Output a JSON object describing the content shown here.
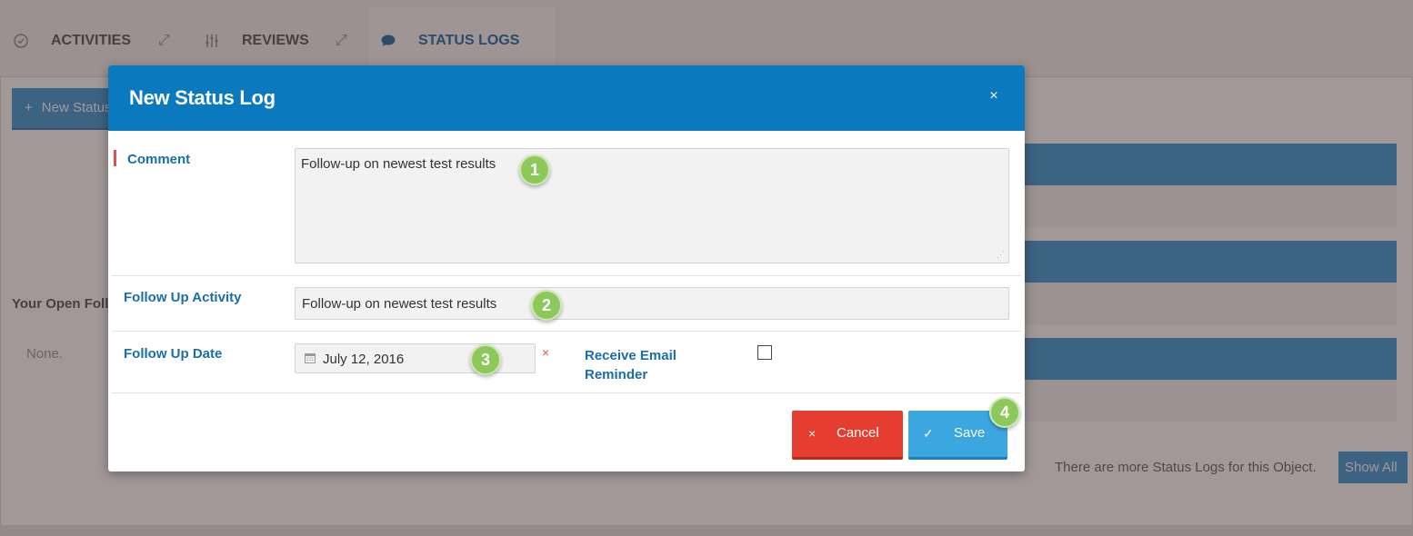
{
  "tabs": {
    "activities": "ACTIVITIES",
    "reviews": "REVIEWS",
    "status_logs": "STATUS LOGS"
  },
  "background": {
    "new_status_button": "New Status",
    "open_follow_heading": "Your Open Follo",
    "none_text": "None.",
    "more_logs_text": "There are more Status Logs for this Object.",
    "show_all_button": "Show All"
  },
  "modal": {
    "title": "New Status Log",
    "close_glyph": "×",
    "comment": {
      "label": "Comment",
      "value": "Follow-up on newest test results",
      "required": true
    },
    "follow_up_activity": {
      "label": "Follow Up Activity",
      "value": "Follow-up on newest test results"
    },
    "follow_up_date": {
      "label": "Follow Up Date",
      "value": "July 12, 2016",
      "clear_glyph": "×"
    },
    "receive_email_reminder": {
      "label": "Receive Email Reminder",
      "checked": false
    },
    "buttons": {
      "cancel_label": "Cancel",
      "cancel_glyph": "×",
      "save_label": "Save",
      "save_glyph": "✓"
    }
  },
  "step_markers": [
    "1",
    "2",
    "3",
    "4"
  ],
  "colors": {
    "header_blue": "#0a79bd",
    "label_blue": "#1a6ea8",
    "cancel_red": "#e53e30",
    "save_blue": "#3ca6e0",
    "marker_green": "#8dc85a"
  }
}
